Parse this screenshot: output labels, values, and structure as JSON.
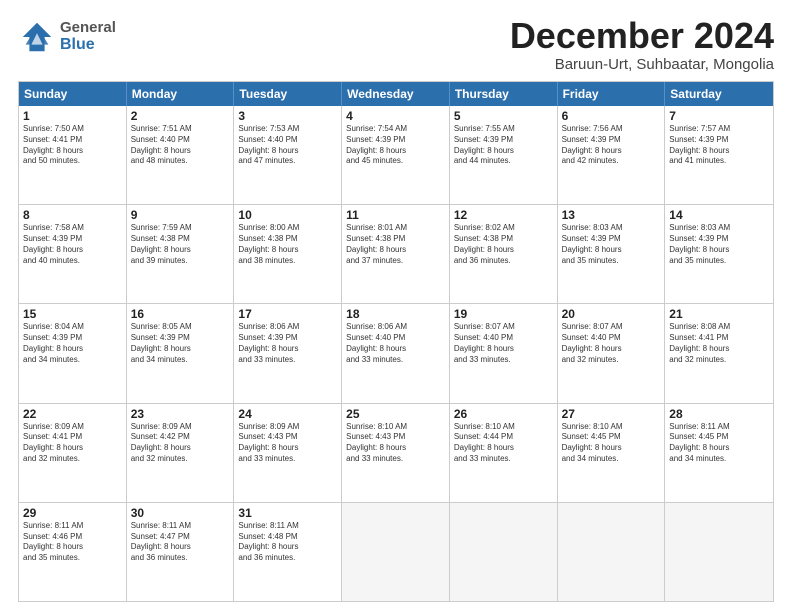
{
  "header": {
    "logo_general": "General",
    "logo_blue": "Blue",
    "month_title": "December 2024",
    "subtitle": "Baruun-Urt, Suhbaatar, Mongolia"
  },
  "weekdays": [
    "Sunday",
    "Monday",
    "Tuesday",
    "Wednesday",
    "Thursday",
    "Friday",
    "Saturday"
  ],
  "weeks": [
    [
      {
        "day": "1",
        "lines": [
          "Sunrise: 7:50 AM",
          "Sunset: 4:41 PM",
          "Daylight: 8 hours",
          "and 50 minutes."
        ]
      },
      {
        "day": "2",
        "lines": [
          "Sunrise: 7:51 AM",
          "Sunset: 4:40 PM",
          "Daylight: 8 hours",
          "and 48 minutes."
        ]
      },
      {
        "day": "3",
        "lines": [
          "Sunrise: 7:53 AM",
          "Sunset: 4:40 PM",
          "Daylight: 8 hours",
          "and 47 minutes."
        ]
      },
      {
        "day": "4",
        "lines": [
          "Sunrise: 7:54 AM",
          "Sunset: 4:39 PM",
          "Daylight: 8 hours",
          "and 45 minutes."
        ]
      },
      {
        "day": "5",
        "lines": [
          "Sunrise: 7:55 AM",
          "Sunset: 4:39 PM",
          "Daylight: 8 hours",
          "and 44 minutes."
        ]
      },
      {
        "day": "6",
        "lines": [
          "Sunrise: 7:56 AM",
          "Sunset: 4:39 PM",
          "Daylight: 8 hours",
          "and 42 minutes."
        ]
      },
      {
        "day": "7",
        "lines": [
          "Sunrise: 7:57 AM",
          "Sunset: 4:39 PM",
          "Daylight: 8 hours",
          "and 41 minutes."
        ]
      }
    ],
    [
      {
        "day": "8",
        "lines": [
          "Sunrise: 7:58 AM",
          "Sunset: 4:39 PM",
          "Daylight: 8 hours",
          "and 40 minutes."
        ]
      },
      {
        "day": "9",
        "lines": [
          "Sunrise: 7:59 AM",
          "Sunset: 4:38 PM",
          "Daylight: 8 hours",
          "and 39 minutes."
        ]
      },
      {
        "day": "10",
        "lines": [
          "Sunrise: 8:00 AM",
          "Sunset: 4:38 PM",
          "Daylight: 8 hours",
          "and 38 minutes."
        ]
      },
      {
        "day": "11",
        "lines": [
          "Sunrise: 8:01 AM",
          "Sunset: 4:38 PM",
          "Daylight: 8 hours",
          "and 37 minutes."
        ]
      },
      {
        "day": "12",
        "lines": [
          "Sunrise: 8:02 AM",
          "Sunset: 4:38 PM",
          "Daylight: 8 hours",
          "and 36 minutes."
        ]
      },
      {
        "day": "13",
        "lines": [
          "Sunrise: 8:03 AM",
          "Sunset: 4:39 PM",
          "Daylight: 8 hours",
          "and 35 minutes."
        ]
      },
      {
        "day": "14",
        "lines": [
          "Sunrise: 8:03 AM",
          "Sunset: 4:39 PM",
          "Daylight: 8 hours",
          "and 35 minutes."
        ]
      }
    ],
    [
      {
        "day": "15",
        "lines": [
          "Sunrise: 8:04 AM",
          "Sunset: 4:39 PM",
          "Daylight: 8 hours",
          "and 34 minutes."
        ]
      },
      {
        "day": "16",
        "lines": [
          "Sunrise: 8:05 AM",
          "Sunset: 4:39 PM",
          "Daylight: 8 hours",
          "and 34 minutes."
        ]
      },
      {
        "day": "17",
        "lines": [
          "Sunrise: 8:06 AM",
          "Sunset: 4:39 PM",
          "Daylight: 8 hours",
          "and 33 minutes."
        ]
      },
      {
        "day": "18",
        "lines": [
          "Sunrise: 8:06 AM",
          "Sunset: 4:40 PM",
          "Daylight: 8 hours",
          "and 33 minutes."
        ]
      },
      {
        "day": "19",
        "lines": [
          "Sunrise: 8:07 AM",
          "Sunset: 4:40 PM",
          "Daylight: 8 hours",
          "and 33 minutes."
        ]
      },
      {
        "day": "20",
        "lines": [
          "Sunrise: 8:07 AM",
          "Sunset: 4:40 PM",
          "Daylight: 8 hours",
          "and 32 minutes."
        ]
      },
      {
        "day": "21",
        "lines": [
          "Sunrise: 8:08 AM",
          "Sunset: 4:41 PM",
          "Daylight: 8 hours",
          "and 32 minutes."
        ]
      }
    ],
    [
      {
        "day": "22",
        "lines": [
          "Sunrise: 8:09 AM",
          "Sunset: 4:41 PM",
          "Daylight: 8 hours",
          "and 32 minutes."
        ]
      },
      {
        "day": "23",
        "lines": [
          "Sunrise: 8:09 AM",
          "Sunset: 4:42 PM",
          "Daylight: 8 hours",
          "and 32 minutes."
        ]
      },
      {
        "day": "24",
        "lines": [
          "Sunrise: 8:09 AM",
          "Sunset: 4:43 PM",
          "Daylight: 8 hours",
          "and 33 minutes."
        ]
      },
      {
        "day": "25",
        "lines": [
          "Sunrise: 8:10 AM",
          "Sunset: 4:43 PM",
          "Daylight: 8 hours",
          "and 33 minutes."
        ]
      },
      {
        "day": "26",
        "lines": [
          "Sunrise: 8:10 AM",
          "Sunset: 4:44 PM",
          "Daylight: 8 hours",
          "and 33 minutes."
        ]
      },
      {
        "day": "27",
        "lines": [
          "Sunrise: 8:10 AM",
          "Sunset: 4:45 PM",
          "Daylight: 8 hours",
          "and 34 minutes."
        ]
      },
      {
        "day": "28",
        "lines": [
          "Sunrise: 8:11 AM",
          "Sunset: 4:45 PM",
          "Daylight: 8 hours",
          "and 34 minutes."
        ]
      }
    ],
    [
      {
        "day": "29",
        "lines": [
          "Sunrise: 8:11 AM",
          "Sunset: 4:46 PM",
          "Daylight: 8 hours",
          "and 35 minutes."
        ]
      },
      {
        "day": "30",
        "lines": [
          "Sunrise: 8:11 AM",
          "Sunset: 4:47 PM",
          "Daylight: 8 hours",
          "and 36 minutes."
        ]
      },
      {
        "day": "31",
        "lines": [
          "Sunrise: 8:11 AM",
          "Sunset: 4:48 PM",
          "Daylight: 8 hours",
          "and 36 minutes."
        ]
      },
      {
        "day": "",
        "lines": []
      },
      {
        "day": "",
        "lines": []
      },
      {
        "day": "",
        "lines": []
      },
      {
        "day": "",
        "lines": []
      }
    ]
  ]
}
